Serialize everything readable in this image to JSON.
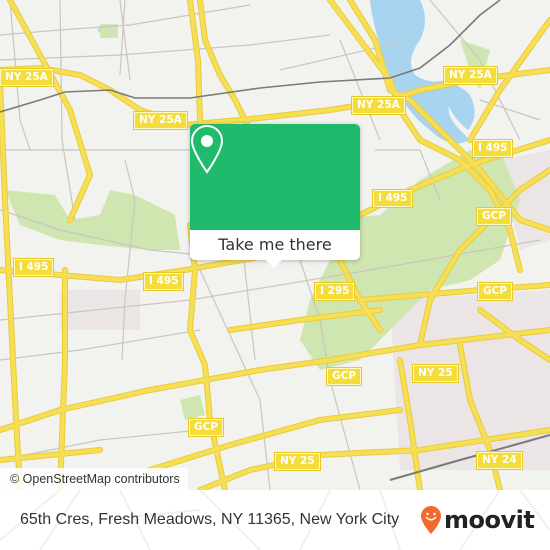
{
  "map": {
    "colors": {
      "background": "#f2f2ee",
      "water": "#a8d4ef",
      "park": "#cfe6b0",
      "urban": "#ebe5e5",
      "road": "#f6de55",
      "road_casing": "#e9cc3c",
      "minor_road": "#c8c6c0",
      "rail": "#7a7a7a"
    },
    "shields": [
      {
        "label": "NY 25A",
        "id": "ny25a-1"
      },
      {
        "label": "NY 25A",
        "id": "ny25a-2"
      },
      {
        "label": "NY 25A",
        "id": "ny25a-3"
      },
      {
        "label": "NY 25A",
        "id": "ny25a-4"
      },
      {
        "label": "I 495",
        "id": "i495-1"
      },
      {
        "label": "I 495",
        "id": "i495-2"
      },
      {
        "label": "I 495",
        "id": "i495-3"
      },
      {
        "label": "I 495",
        "id": "i495-4"
      },
      {
        "label": "I 295",
        "id": "i295"
      },
      {
        "label": "GCP",
        "id": "gcp-1"
      },
      {
        "label": "GCP",
        "id": "gcp-2"
      },
      {
        "label": "GCP",
        "id": "gcp-3"
      },
      {
        "label": "GCP",
        "id": "gcp-4"
      },
      {
        "label": "NY 25",
        "id": "ny25-1"
      },
      {
        "label": "NY 25",
        "id": "ny25-2"
      },
      {
        "label": "NY 24",
        "id": "ny24"
      }
    ],
    "attribution": "© OpenStreetMap contributors"
  },
  "popup": {
    "color": "#1fba6c",
    "icon": "map-pin-icon",
    "button_label": "Take me there"
  },
  "footer": {
    "address": "65th Cres, Fresh Meadows, NY 11365, New York City",
    "brand": "moovit",
    "brand_color": "#f26a2e"
  }
}
